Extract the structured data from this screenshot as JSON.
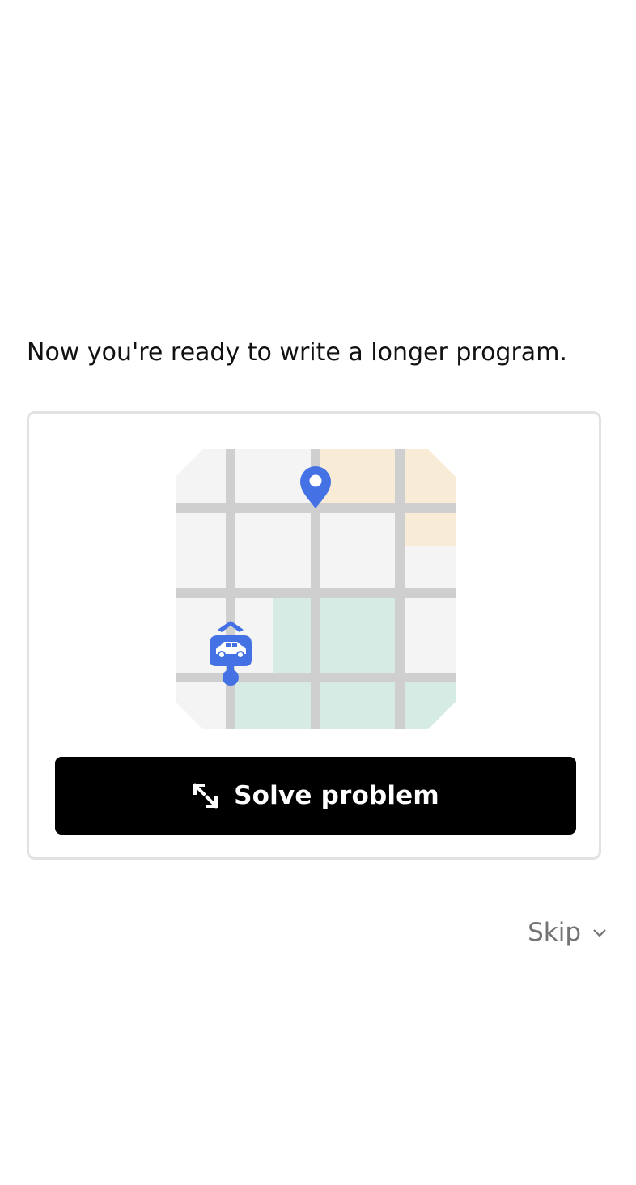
{
  "lesson": {
    "intro_text": "Now you're ready to write a longer program."
  },
  "card": {
    "illustration_icon": "map-route-illustration",
    "solve_button": {
      "label": "Solve problem",
      "icon": "expand-icon"
    }
  },
  "footer": {
    "skip_label": "Skip",
    "skip_icon": "chevron-down-icon"
  },
  "colors": {
    "accent_blue": "#4472e4",
    "road_gray": "#cfcfcf",
    "block_gray": "#f4f4f4",
    "block_sand": "#f8ecd6",
    "block_mint": "#d7ebe5",
    "button_black": "#000000",
    "card_border": "#e2e2e2",
    "muted_text": "#737373"
  }
}
